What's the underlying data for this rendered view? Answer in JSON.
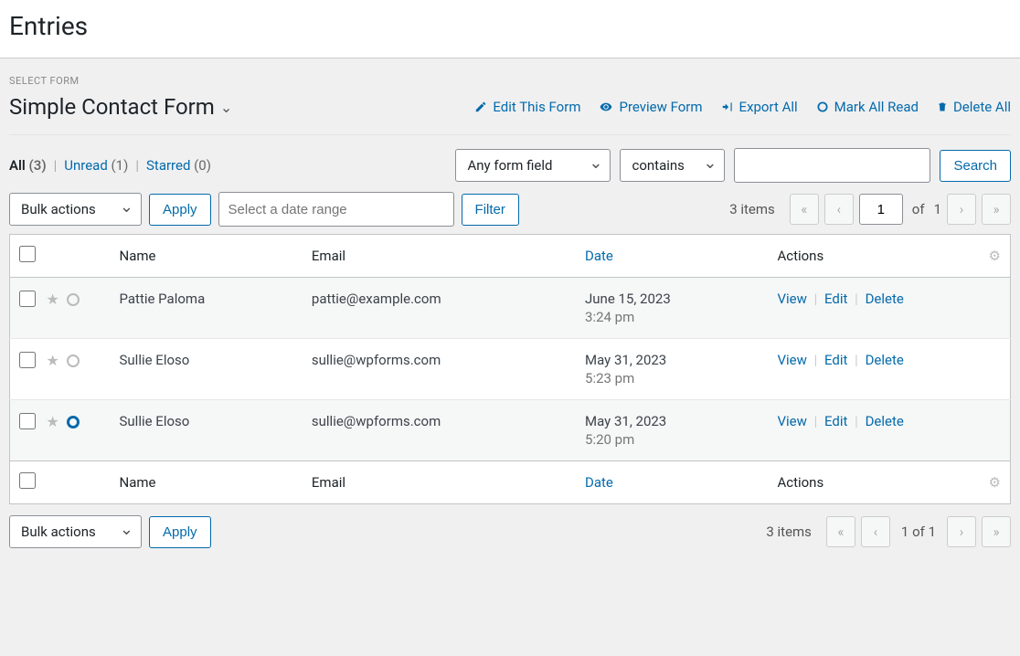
{
  "page_title": "Entries",
  "select_form_label": "SELECT FORM",
  "form_name": "Simple Contact Form",
  "actions": {
    "edit": "Edit This Form",
    "preview": "Preview Form",
    "export": "Export All",
    "mark_read": "Mark All Read",
    "delete_all": "Delete All"
  },
  "status_tabs": {
    "all": {
      "label": "All",
      "count": "(3)"
    },
    "unread": {
      "label": "Unread",
      "count": "(1)"
    },
    "starred": {
      "label": "Starred",
      "count": "(0)"
    }
  },
  "search": {
    "field_select": "Any form field",
    "operator_select": "contains",
    "button": "Search"
  },
  "bulk": {
    "select_label": "Bulk actions",
    "apply": "Apply",
    "date_placeholder": "Select a date range",
    "filter": "Filter"
  },
  "pagination": {
    "items_text": "3 items",
    "current_page": "1",
    "of_label": "of",
    "total_pages": "1",
    "combined": "1 of 1"
  },
  "columns": {
    "name": "Name",
    "email": "Email",
    "date": "Date",
    "actions": "Actions"
  },
  "row_actions": {
    "view": "View",
    "edit": "Edit",
    "delete": "Delete"
  },
  "entries": [
    {
      "name": "Pattie Paloma",
      "email": "pattie@example.com",
      "date": "June 15, 2023",
      "time": "3:24 pm",
      "unread": false
    },
    {
      "name": "Sullie Eloso",
      "email": "sullie@wpforms.com",
      "date": "May 31, 2023",
      "time": "5:23 pm",
      "unread": false
    },
    {
      "name": "Sullie Eloso",
      "email": "sullie@wpforms.com",
      "date": "May 31, 2023",
      "time": "5:20 pm",
      "unread": true
    }
  ]
}
